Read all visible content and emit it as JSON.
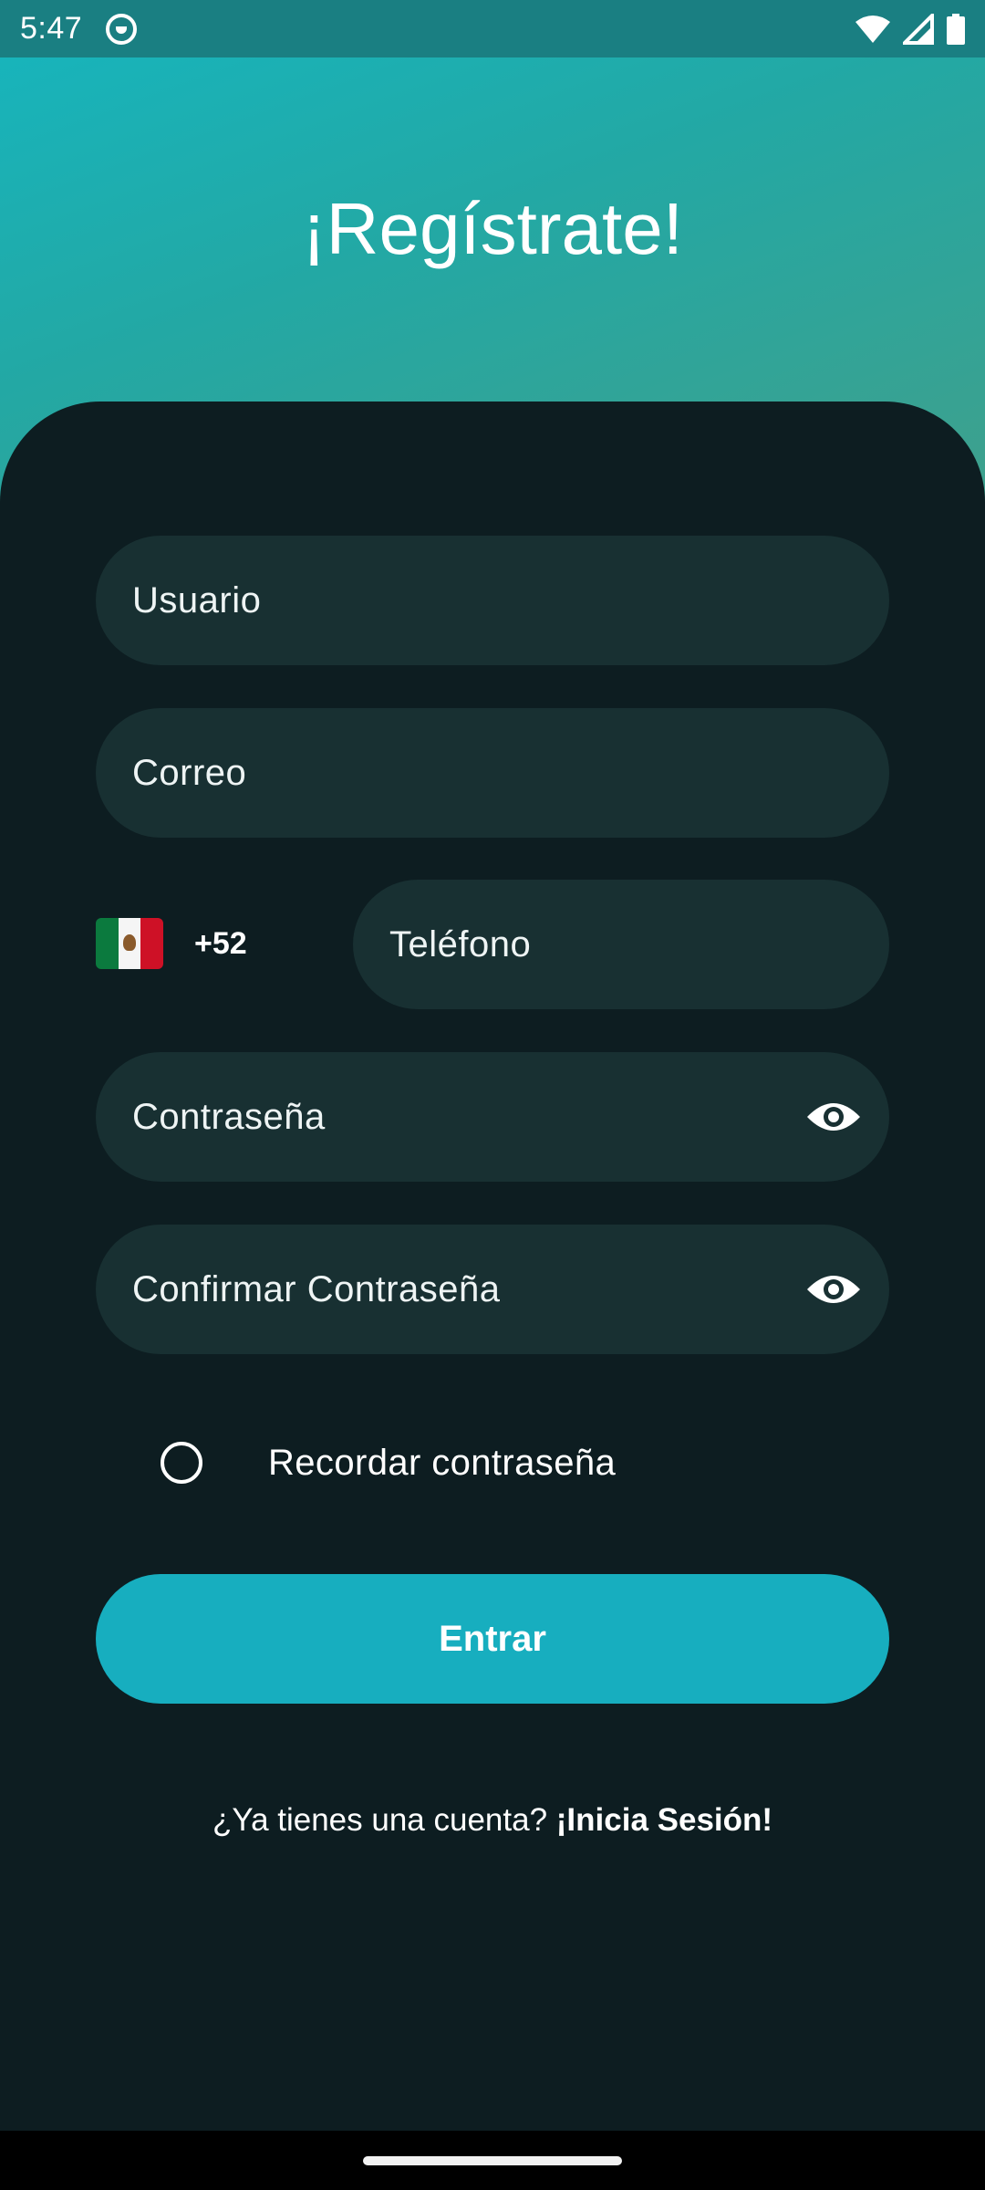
{
  "status_bar": {
    "time": "5:47",
    "icons": [
      "app-notification-icon",
      "wifi-icon",
      "signal-icon",
      "battery-icon"
    ]
  },
  "header": {
    "title": "¡Regístrate!"
  },
  "form": {
    "username_placeholder": "Usuario",
    "email_placeholder": "Correo",
    "country_flag": "mexico-flag-icon",
    "dial_code": "+52",
    "phone_placeholder": "Teléfono",
    "password_placeholder": "Contraseña",
    "confirm_password_placeholder": "Confirmar Contraseña",
    "remember_label": "Recordar contraseña",
    "submit_label": "Entrar"
  },
  "footer": {
    "prompt": "¿Ya tienes una cuenta? ",
    "login_link": "¡Inicia Sesión!"
  },
  "colors": {
    "gradient_start": "#16b6bf",
    "gradient_end": "#3fa08c",
    "background": "#0d1d21",
    "field": "#183032",
    "accent": "#17aebf"
  }
}
